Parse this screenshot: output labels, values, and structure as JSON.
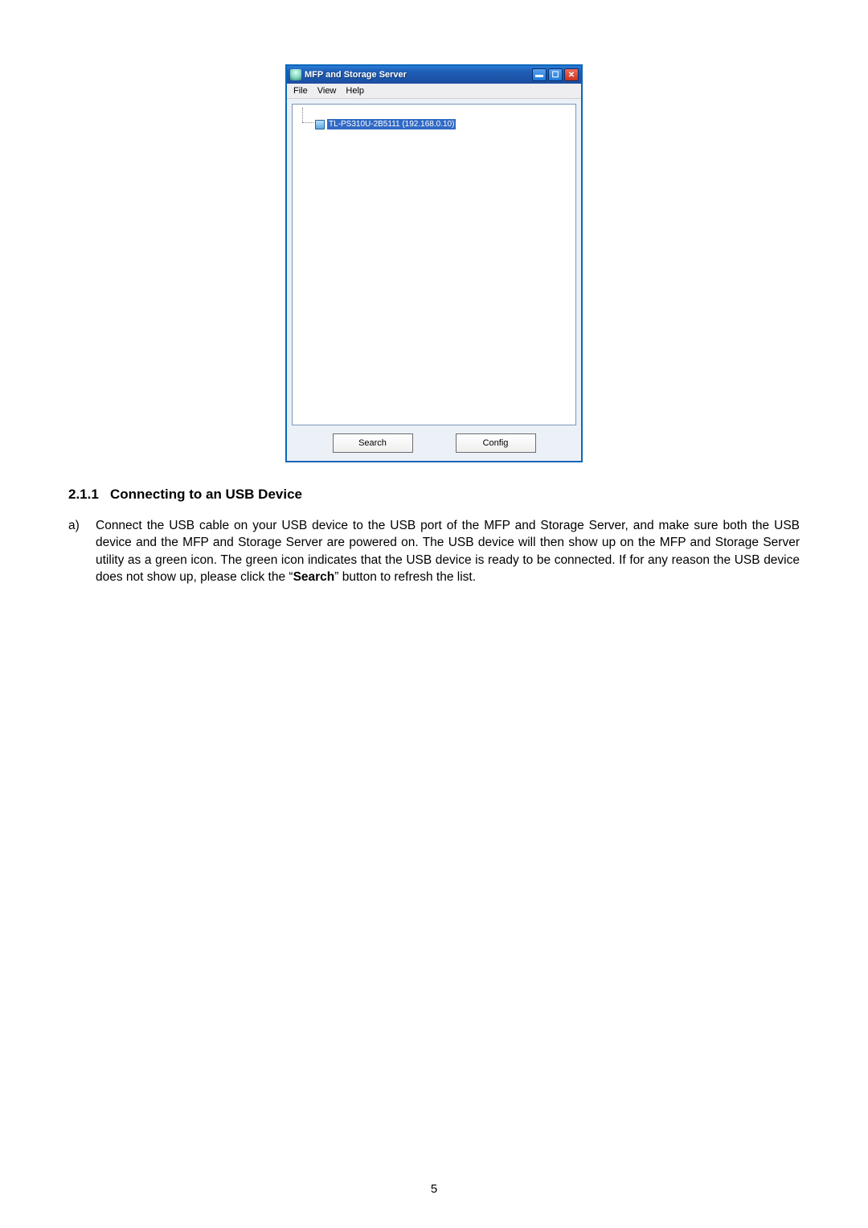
{
  "app": {
    "title": "MFP and Storage Server",
    "menubar": {
      "file": "File",
      "view": "View",
      "help": "Help"
    },
    "window_controls": {
      "minimize_glyph": "▬",
      "maximize_glyph": "☐",
      "close_glyph": "✕"
    },
    "tree": {
      "selected_item_text": "TL-PS310U-2B5111 (192.168.0.10)"
    },
    "buttons": {
      "search": "Search",
      "config": "Config"
    }
  },
  "doc": {
    "section_number": "2.1.1",
    "section_title": "Connecting to an USB Device",
    "list_item_letter": "a",
    "para_part1": "Connect the USB cable on your USB device to the USB port of the MFP and Storage Server, and make sure both the USB device and the MFP and Storage Server are powered on. The USB device will then show up on the MFP and Storage Server utility as a green icon. The green icon indicates that the USB device is ready to be connected. If for any reason the USB device does not show up, please click the “",
    "para_bold": "Search",
    "para_part2": "” button to refresh the list.",
    "page_number": "5"
  }
}
